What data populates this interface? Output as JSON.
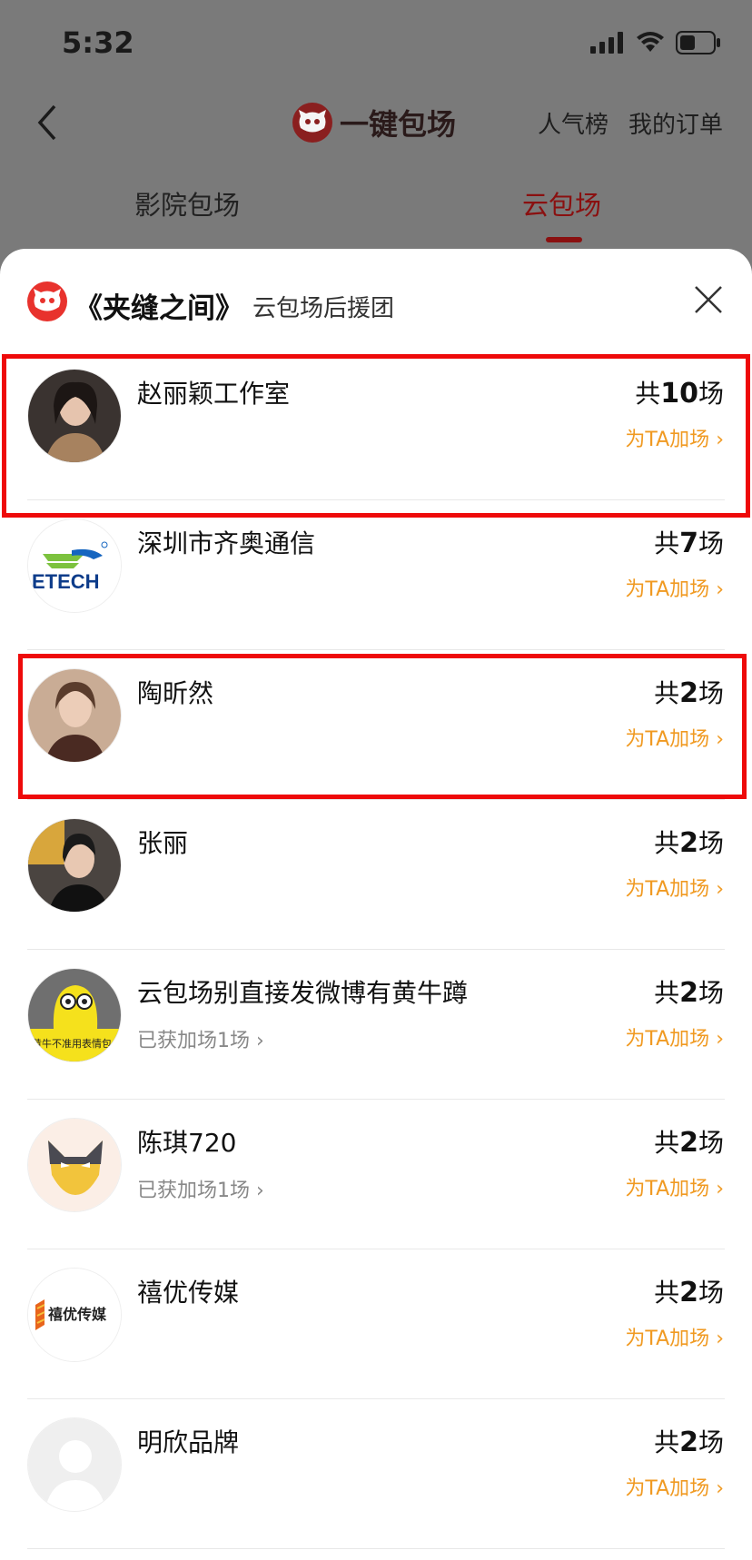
{
  "status_bar": {
    "time": "5:32"
  },
  "nav": {
    "title": "一键包场",
    "right_links": [
      "人气榜",
      "我的订单"
    ]
  },
  "tabs": [
    {
      "label": "影院包场",
      "active": false
    },
    {
      "label": "云包场",
      "active": true
    }
  ],
  "sheet": {
    "title": "《夹缝之间》",
    "subtitle": "云包场后援团"
  },
  "rows": [
    {
      "name": "赵丽颖工作室",
      "sub": "",
      "count_prefix": "共",
      "count": "10",
      "count_suffix": "场",
      "action": "为TA加场",
      "avatar": "person-photo",
      "highlighted": true
    },
    {
      "name": "深圳市齐奥通信",
      "sub": "",
      "count_prefix": "共",
      "count": "7",
      "count_suffix": "场",
      "action": "为TA加场",
      "avatar": "etech-logo",
      "avatar_text": "ETECH",
      "highlighted": false
    },
    {
      "name": "陶昕然",
      "sub": "",
      "count_prefix": "共",
      "count": "2",
      "count_suffix": "场",
      "action": "为TA加场",
      "avatar": "person-photo",
      "highlighted": true
    },
    {
      "name": "张丽",
      "sub": "",
      "count_prefix": "共",
      "count": "2",
      "count_suffix": "场",
      "action": "为TA加场",
      "avatar": "person-photo",
      "highlighted": false
    },
    {
      "name": "云包场别直接发微博有黄牛蹲",
      "sub": "已获加场1场",
      "count_prefix": "共",
      "count": "2",
      "count_suffix": "场",
      "action": "为TA加场",
      "avatar": "cartoon-avatar",
      "avatar_text": "黄牛不准用表情包",
      "highlighted": false
    },
    {
      "name": "陈琪720",
      "sub": "已获加场1场",
      "count_prefix": "共",
      "count": "2",
      "count_suffix": "场",
      "action": "为TA加场",
      "avatar": "mask-avatar",
      "highlighted": false
    },
    {
      "name": "禧优传媒",
      "sub": "",
      "count_prefix": "共",
      "count": "2",
      "count_suffix": "场",
      "action": "为TA加场",
      "avatar": "brand-logo",
      "avatar_text": "禧优传媒",
      "highlighted": false
    },
    {
      "name": "明欣品牌",
      "sub": "",
      "count_prefix": "共",
      "count": "2",
      "count_suffix": "场",
      "action": "为TA加场",
      "avatar": "default-avatar",
      "highlighted": false
    }
  ],
  "colors": {
    "accent": "#f09a22",
    "brand": "#e8322d",
    "highlight": "#ee0a0a",
    "active_tab": "#8a1010"
  }
}
